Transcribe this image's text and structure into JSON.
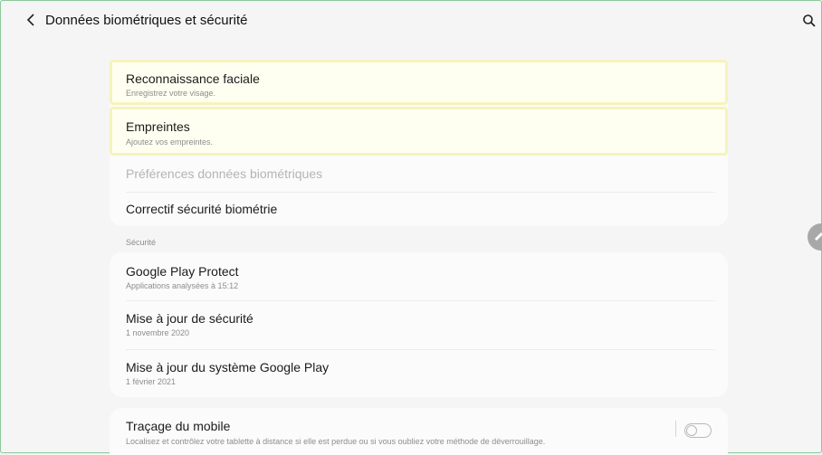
{
  "header": {
    "title": "Données biométriques et sécurité"
  },
  "biometrics": {
    "face": {
      "label": "Reconnaissance faciale",
      "sub": "Enregistrez votre visage."
    },
    "fingerprints": {
      "label": "Empreintes",
      "sub": "Ajoutez vos empreintes."
    },
    "preferences": {
      "label": "Préférences données biométriques"
    },
    "patch": {
      "label": "Correctif sécurité biométrie"
    }
  },
  "security_section": {
    "label": "Sécurité",
    "play_protect": {
      "label": "Google Play Protect",
      "sub": "Applications analysées à 15:12"
    },
    "security_update": {
      "label": "Mise à jour de sécurité",
      "sub": "1 novembre 2020"
    },
    "play_system_update": {
      "label": "Mise à jour du système Google Play",
      "sub": "1 février 2021"
    }
  },
  "find_mobile": {
    "label": "Traçage du mobile",
    "sub": "Localisez et contrôlez votre tablette à distance si elle est perdue ou si vous oubliez votre méthode de déverrouillage.",
    "toggle_on": false
  },
  "colors": {
    "highlight_border": "#f6f3bc",
    "background": "#f4f4f4",
    "frame_border": "#8cc79a"
  }
}
